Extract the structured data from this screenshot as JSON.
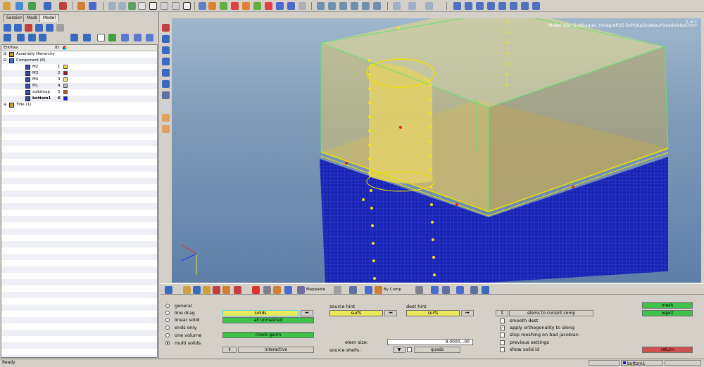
{
  "tabs": [
    "Session",
    "Mask",
    "Model"
  ],
  "tree": {
    "header_entities": "Entities",
    "header_id": "ID",
    "rows": [
      {
        "label": "Assembly Hierarchy",
        "id": "",
        "color": ""
      },
      {
        "label": "Component (6)",
        "id": "",
        "color": ""
      },
      {
        "label": "M2",
        "id": "1",
        "color": "#f2d24a"
      },
      {
        "label": "M3",
        "id": "2",
        "color": "#8a1a32"
      },
      {
        "label": "M4",
        "id": "3",
        "color": "#f2e07a"
      },
      {
        "label": "M1",
        "id": "4",
        "color": "#b8b8c8"
      },
      {
        "label": "solidmap",
        "id": "5",
        "color": "#c8583a"
      },
      {
        "label": "bottom1",
        "id": "6",
        "color": "#1a1ae0"
      },
      {
        "label": "Title (1)",
        "id": "",
        "color": ""
      }
    ]
  },
  "viewport": {
    "page": "1 of 1",
    "model_info": "Model Info: G:\\Abaqus\\_Hntegref\\3D Bolt\\duplicatesurfacedeleted.hm*"
  },
  "bottom_toolbar": {
    "mappable": "Mappable",
    "by_comp": "By Comp"
  },
  "panel": {
    "radios": [
      {
        "label": "general",
        "on": false
      },
      {
        "label": "line drag",
        "on": false
      },
      {
        "label": "linear solid",
        "on": false
      },
      {
        "label": "ends only",
        "on": false
      },
      {
        "label": "one volume",
        "on": false
      },
      {
        "label": "multi solids",
        "on": true
      }
    ],
    "solids_label": "solids",
    "all_unmeshed": "all unmeshed",
    "check_geom": "check geom",
    "interactive": "interactive",
    "source_hint": "source hint",
    "source_surfs": "surfs",
    "dest_hint": "dest hint",
    "dest_surfs": "surfs",
    "elem_size_label": "elem size:",
    "elem_size_value": "9.0000...00",
    "source_shells_label": "source shells:",
    "quads": "quads",
    "elems_to_current_comp": "elems to current comp",
    "options": [
      {
        "label": "smooth dest",
        "checked": false
      },
      {
        "label": "apply orthogonality to along",
        "checked": true
      },
      {
        "label": "stop meshing on bad jacobian",
        "checked": false
      },
      {
        "label": "previous settings",
        "checked": false
      },
      {
        "label": "show solid id",
        "checked": false
      }
    ],
    "mesh": "mesh",
    "reject": "reject",
    "return": "return"
  },
  "status": {
    "ready": "Ready",
    "component": "bottom1"
  },
  "colors": {
    "solid_yellow": "#c9b45a",
    "mesh_blue": "#1a24b4",
    "edge_green": "#66e070",
    "yellow_button": "#e8e85a",
    "green_button": "#3ec24a",
    "red_button": "#d05050"
  }
}
